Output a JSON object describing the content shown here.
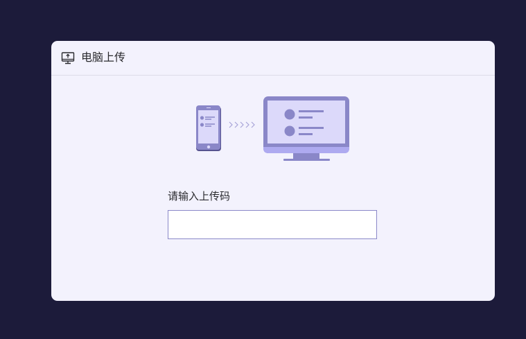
{
  "dialog": {
    "header": {
      "icon": "monitor-upload-icon",
      "title": "电脑上传"
    },
    "illustration": {
      "phone_icon": "smartphone-icon",
      "arrows_icon": "chevrons-right-icon",
      "monitor_icon": "desktop-monitor-icon"
    },
    "form": {
      "label": "请输入上传码",
      "input_value": "",
      "input_placeholder": ""
    }
  },
  "colors": {
    "page_background": "#1c1b3a",
    "dialog_background": "#f3f2fd",
    "accent": "#8a87c8",
    "accent_light": "#dcd9fa"
  }
}
